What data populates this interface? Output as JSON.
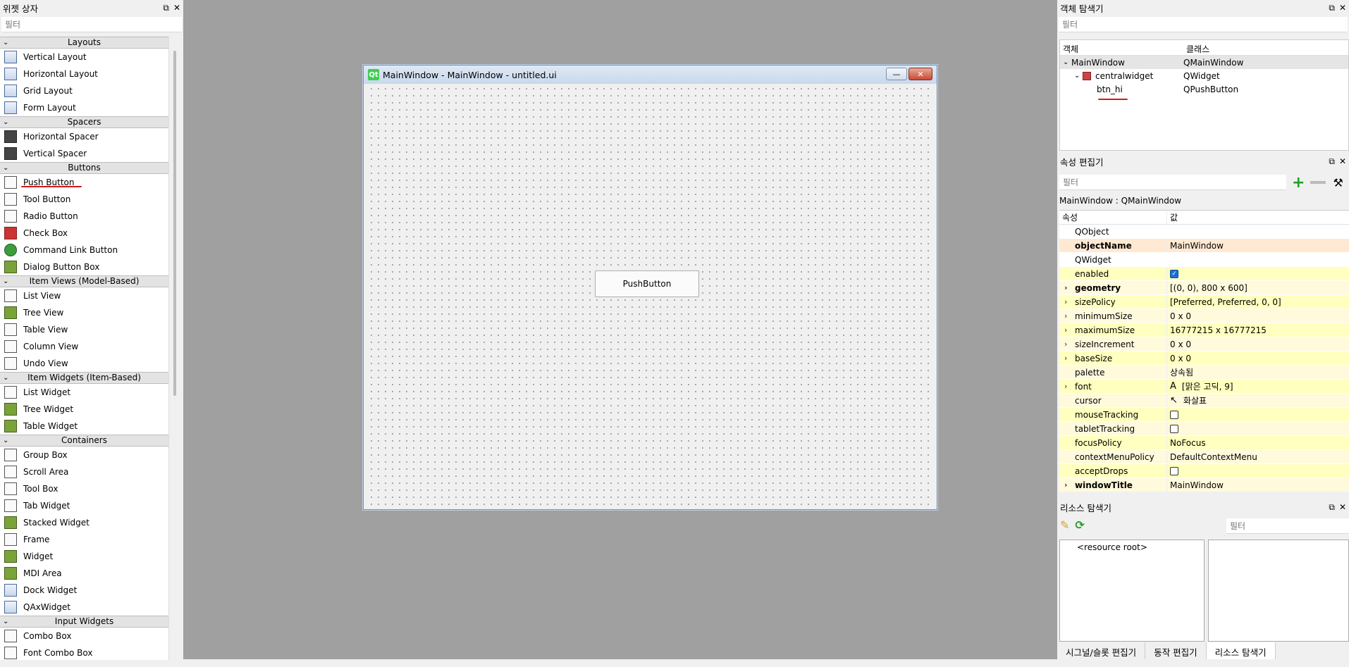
{
  "left": {
    "title": "위젯 상자",
    "filter_placeholder": "필터",
    "categories": [
      {
        "label": "Layouts",
        "items": [
          "Vertical Layout",
          "Horizontal Layout",
          "Grid Layout",
          "Form Layout"
        ]
      },
      {
        "label": "Spacers",
        "items": [
          "Horizontal Spacer",
          "Vertical Spacer"
        ]
      },
      {
        "label": "Buttons",
        "items": [
          "Push Button",
          "Tool Button",
          "Radio Button",
          "Check Box",
          "Command Link Button",
          "Dialog Button Box"
        ]
      },
      {
        "label": "Item Views (Model-Based)",
        "items": [
          "List View",
          "Tree View",
          "Table View",
          "Column View",
          "Undo View"
        ]
      },
      {
        "label": "Item Widgets (Item-Based)",
        "items": [
          "List Widget",
          "Tree Widget",
          "Table Widget"
        ]
      },
      {
        "label": "Containers",
        "items": [
          "Group Box",
          "Scroll Area",
          "Tool Box",
          "Tab Widget",
          "Stacked Widget",
          "Frame",
          "Widget",
          "MDI Area",
          "Dock Widget",
          "QAxWidget"
        ]
      },
      {
        "label": "Input Widgets",
        "items": [
          "Combo Box",
          "Font Combo Box"
        ]
      }
    ]
  },
  "form": {
    "title": "MainWindow - MainWindow - untitled.ui",
    "logo": "Qt",
    "button_label": "PushButton"
  },
  "objects": {
    "title": "객체 탐색기",
    "filter_placeholder": "필터",
    "col_object": "객체",
    "col_class": "클래스",
    "rows": [
      {
        "name": "MainWindow",
        "cls": "QMainWindow"
      },
      {
        "name": "centralwidget",
        "cls": "QWidget"
      },
      {
        "name": "btn_hi",
        "cls": "QPushButton"
      }
    ]
  },
  "props": {
    "title": "속성 편집기",
    "filter_placeholder": "필터",
    "context": "MainWindow : QMainWindow",
    "col_prop": "속성",
    "col_value": "값",
    "rows": [
      {
        "name": "QObject",
        "value": "",
        "kind": "group"
      },
      {
        "name": "objectName",
        "value": "MainWindow",
        "kind": "pk",
        "bold": true
      },
      {
        "name": "QWidget",
        "value": "",
        "kind": "group"
      },
      {
        "name": "enabled",
        "value": "",
        "kind": "y",
        "check": "on"
      },
      {
        "name": "geometry",
        "value": "[(0, 0), 800 x 600]",
        "kind": "y2",
        "bold": true,
        "exp": true
      },
      {
        "name": "sizePolicy",
        "value": "[Preferred, Preferred, 0, 0]",
        "kind": "y",
        "exp": true
      },
      {
        "name": "minimumSize",
        "value": "0 x 0",
        "kind": "y2",
        "exp": true
      },
      {
        "name": "maximumSize",
        "value": "16777215 x 16777215",
        "kind": "y",
        "exp": true
      },
      {
        "name": "sizeIncrement",
        "value": "0 x 0",
        "kind": "y2",
        "exp": true
      },
      {
        "name": "baseSize",
        "value": "0 x 0",
        "kind": "y",
        "exp": true
      },
      {
        "name": "palette",
        "value": "상속됨",
        "kind": "y2"
      },
      {
        "name": "font",
        "value": "[맑은 고딕, 9]",
        "kind": "y",
        "exp": true,
        "prefix": "A"
      },
      {
        "name": "cursor",
        "value": "화살표",
        "kind": "y2",
        "prefix": "↖"
      },
      {
        "name": "mouseTracking",
        "value": "",
        "kind": "y",
        "check": "off"
      },
      {
        "name": "tabletTracking",
        "value": "",
        "kind": "y2",
        "check": "off"
      },
      {
        "name": "focusPolicy",
        "value": "NoFocus",
        "kind": "y"
      },
      {
        "name": "contextMenuPolicy",
        "value": "DefaultContextMenu",
        "kind": "y2"
      },
      {
        "name": "acceptDrops",
        "value": "",
        "kind": "y",
        "check": "off"
      },
      {
        "name": "windowTitle",
        "value": "MainWindow",
        "kind": "y2",
        "bold": true,
        "exp": true
      }
    ]
  },
  "resources": {
    "title": "리소스 탐색기",
    "filter_placeholder": "필터",
    "root": "<resource root>",
    "tabs": [
      "시그널/슬롯 편집기",
      "동작 편집기",
      "리소스 탐색기"
    ]
  },
  "colors": {
    "annotation": "#d31a1a",
    "qt_green": "#41cd52",
    "group_bg": "#a4a4a4"
  }
}
